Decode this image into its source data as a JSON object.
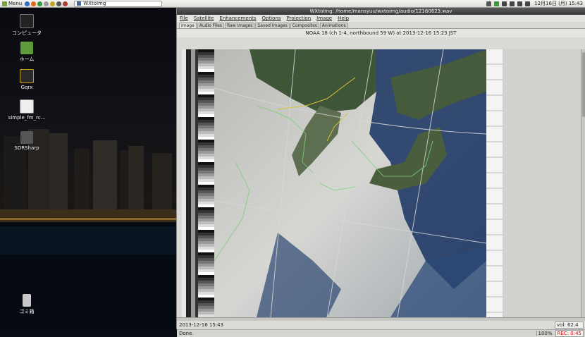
{
  "panel": {
    "menu_label": "Menu",
    "task_label": "WXtoImg",
    "clock": "12月16日 (月) 15:43"
  },
  "desktop": {
    "icons": [
      {
        "label": "コンピュータ"
      },
      {
        "label": "ホーム"
      },
      {
        "label": "Gqrx"
      },
      {
        "label": "simple_fm_rc..."
      },
      {
        "label": "SDRSharp"
      },
      {
        "label": "ゴミ箱"
      }
    ]
  },
  "window": {
    "title": "WXtoImg: /home/mansyuu/wxtoimg/audio/12160623.wav",
    "menus": [
      "File",
      "Satellite",
      "Enhancements",
      "Options",
      "Projection",
      "Image",
      "Help"
    ],
    "tabs": [
      "Image",
      "Audio Files",
      "Raw Images",
      "Saved Images",
      "Composites",
      "Animations"
    ],
    "active_tab": "Image",
    "image_caption": "NOAA 18 (ch 1-4, northbound 59 W) at 2013-12-16  15:23 JST",
    "status_time": "2013-12-16  15:43",
    "volume": "vol: 62.4",
    "status_message": "Done.",
    "zoom": "100%",
    "rec": "REC: 0:45"
  }
}
